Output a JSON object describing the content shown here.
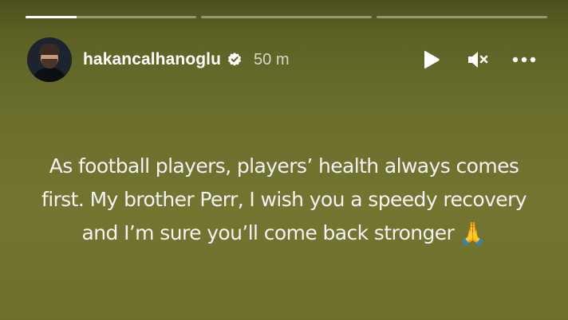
{
  "progress": {
    "segments": [
      {
        "fill": 0.3
      },
      {
        "fill": 0
      },
      {
        "fill": 0
      }
    ]
  },
  "header": {
    "username": "hakancalhanoglu",
    "time": "50 m",
    "verified_icon": "verified-badge-icon",
    "controls": [
      "play-icon",
      "mute-icon",
      "more-icon"
    ]
  },
  "caption": {
    "line1": "As football players, players’ health always comes",
    "line2": "first. My brother Perr, I wish you a speedy recovery",
    "line3": "and I’m sure you’ll come back stronger",
    "emoji": "🙏"
  },
  "colors": {
    "background": "#6b6f2c",
    "text": "#ffffff"
  }
}
